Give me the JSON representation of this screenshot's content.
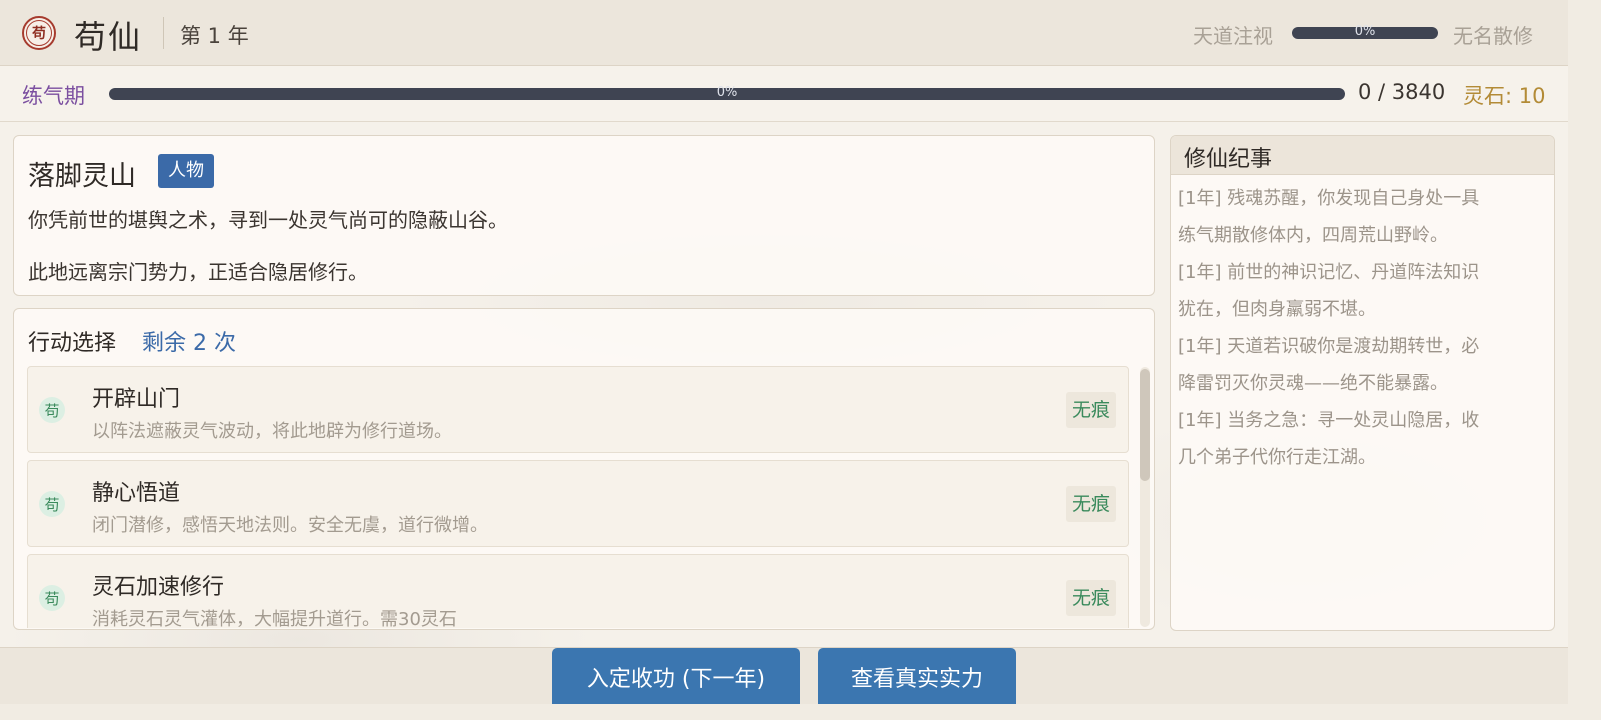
{
  "header": {
    "logo_char": "苟",
    "title": "苟仙",
    "year": "第 1 年",
    "watch_label": "天道注视",
    "watch_pct": "0%",
    "player_name": "无名散修"
  },
  "realm": {
    "label": "练气期",
    "progress_pct": "0%",
    "count": "0 / 3840",
    "stones": "灵石: 10"
  },
  "event": {
    "title": "落脚灵山",
    "tag": "人物",
    "line1": "你凭前世的堪舆之术，寻到一处灵气尚可的隐蔽山谷。",
    "line2": "此地远离宗门势力，正适合隐居修行。"
  },
  "actions": {
    "heading": "行动选择",
    "remaining": "剩余 2 次",
    "items": [
      {
        "icon": "苟",
        "name": "开辟山门",
        "desc": "以阵法遮蔽灵气波动，将此地辟为修行道场。",
        "badge": "无痕"
      },
      {
        "icon": "苟",
        "name": "静心悟道",
        "desc": "闭门潜修，感悟天地法则。安全无虞，道行微增。",
        "badge": "无痕"
      },
      {
        "icon": "苟",
        "name": "灵石加速修行",
        "desc": "消耗灵石灵气灌体，大幅提升道行。需30灵石",
        "badge": "无痕"
      }
    ]
  },
  "chronicle": {
    "title": "修仙纪事",
    "entries": [
      "[1年] 残魂苏醒，你发现自己身处一具",
      "练气期散修体内，四周荒山野岭。",
      "[1年] 前世的神识记忆、丹道阵法知识",
      "犹在，但肉身羸弱不堪。",
      "[1年] 天道若识破你是渡劫期转世，必",
      "降雷罚灭你灵魂——绝不能暴露。",
      "[1年] 当务之急：寻一处灵山隐居，收",
      "几个弟子代你行走江湖。"
    ]
  },
  "footer": {
    "next_label": "入定收功 (下一年)",
    "power_label": "查看真实实力"
  }
}
